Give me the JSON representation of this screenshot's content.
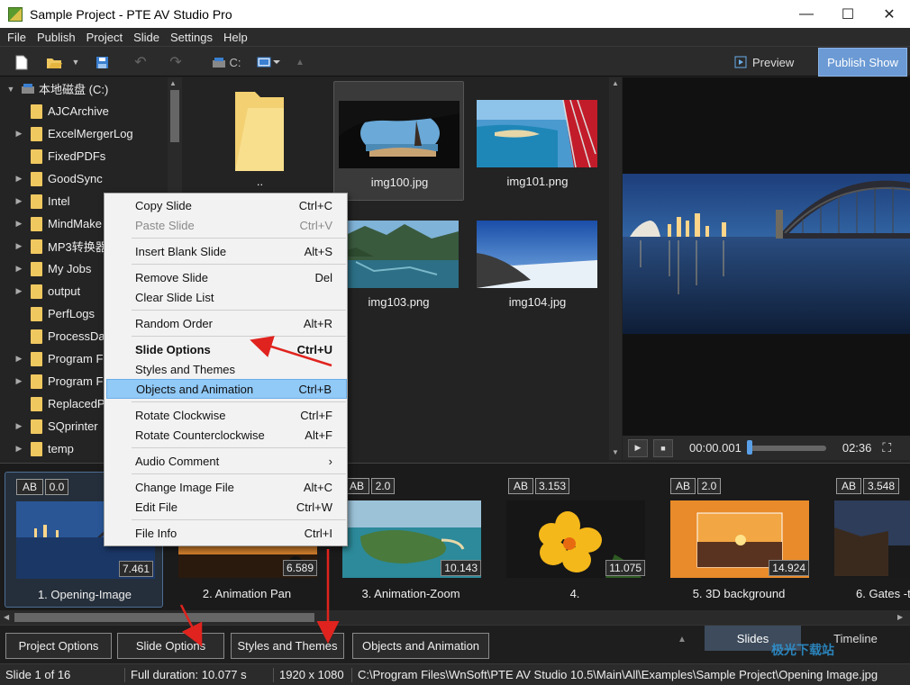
{
  "window": {
    "title": "Sample Project - PTE AV Studio Pro",
    "min": "—",
    "max": "☐",
    "close": "✕"
  },
  "menu": [
    "File",
    "Publish",
    "Project",
    "Slide",
    "Settings",
    "Help"
  ],
  "toolbar": {
    "drive": "C:",
    "preview": "Preview",
    "publish": "Publish Show"
  },
  "tree": {
    "root": "本地磁盘 (C:)",
    "items": [
      {
        "label": "AJCArchive",
        "exp": false
      },
      {
        "label": "ExcelMergerLog",
        "exp": true
      },
      {
        "label": "FixedPDFs",
        "exp": false
      },
      {
        "label": "GoodSync",
        "exp": true
      },
      {
        "label": "Intel",
        "exp": true
      },
      {
        "label": "MindMake",
        "exp": true
      },
      {
        "label": "MP3转换器",
        "exp": true
      },
      {
        "label": "My Jobs",
        "exp": true
      },
      {
        "label": "output",
        "exp": true
      },
      {
        "label": "PerfLogs",
        "exp": false
      },
      {
        "label": "ProcessDa",
        "exp": false
      },
      {
        "label": "Program F",
        "exp": true
      },
      {
        "label": "Program F",
        "exp": true
      },
      {
        "label": "ReplacedP",
        "exp": false
      },
      {
        "label": "SQprinter",
        "exp": true
      },
      {
        "label": "temp",
        "exp": true
      }
    ]
  },
  "files": [
    {
      "label": ".."
    },
    {
      "label": "img100.jpg"
    },
    {
      "label": "img101.png"
    },
    {
      "label": "img103.png"
    },
    {
      "label": "img104.jpg"
    }
  ],
  "player": {
    "time": "00:00.001",
    "duration": "02:36"
  },
  "context_menu": [
    {
      "label": "Copy Slide",
      "key": "Ctrl+C"
    },
    {
      "label": "Paste Slide",
      "key": "Ctrl+V"
    },
    {
      "label": "Insert Blank Slide",
      "key": "Alt+S"
    },
    {
      "label": "Remove Slide",
      "key": "Del"
    },
    {
      "label": "Clear Slide List",
      "key": ""
    },
    {
      "label": "Random Order",
      "key": "Alt+R"
    },
    {
      "label": "Slide Options",
      "key": "Ctrl+U"
    },
    {
      "label": "Styles and Themes",
      "key": ""
    },
    {
      "label": "Objects and Animation",
      "key": "Ctrl+B"
    },
    {
      "label": "Rotate Clockwise",
      "key": "Ctrl+F"
    },
    {
      "label": "Rotate Counterclockwise",
      "key": "Alt+F"
    },
    {
      "label": "Audio Comment",
      "key": "›"
    },
    {
      "label": "Change Image File",
      "key": "Alt+C"
    },
    {
      "label": "Edit File",
      "key": "Ctrl+W"
    },
    {
      "label": "File Info",
      "key": "Ctrl+I"
    }
  ],
  "slides": [
    {
      "ab": "AB",
      "t": "0.0",
      "dur": "7.461",
      "name": "1. Opening-Image"
    },
    {
      "ab": "",
      "t": "",
      "dur": "6.589",
      "name": "2. Animation Pan"
    },
    {
      "ab": "AB",
      "t": "2.0",
      "dur": "10.143",
      "name": "3. Animation-Zoom"
    },
    {
      "ab": "AB",
      "t": "3.153",
      "dur": "11.075",
      "name": "4."
    },
    {
      "ab": "AB",
      "t": "2.0",
      "dur": "14.924",
      "name": "5. 3D background"
    },
    {
      "ab": "AB",
      "t": "3.548",
      "dur": "",
      "name": "6. Gates -t"
    }
  ],
  "bottom_buttons": [
    "Project Options",
    "Slide Options",
    "Styles and Themes",
    "Objects and Animation"
  ],
  "tabs": {
    "slides": "Slides",
    "timeline": "Timeline"
  },
  "status": {
    "slide": "Slide 1 of 16",
    "duration": "Full duration: 10.077 s",
    "res": "1920 x 1080",
    "path": "C:\\Program Files\\WnSoft\\PTE AV Studio 10.5\\Main\\All\\Examples\\Sample Project\\Opening Image.jpg"
  },
  "watermark": "极光下载站",
  "colors": {
    "accent": "#6b9ad4",
    "highlight": "#91c9f7",
    "arrow": "#e0231e",
    "folder": "#f0c860"
  }
}
